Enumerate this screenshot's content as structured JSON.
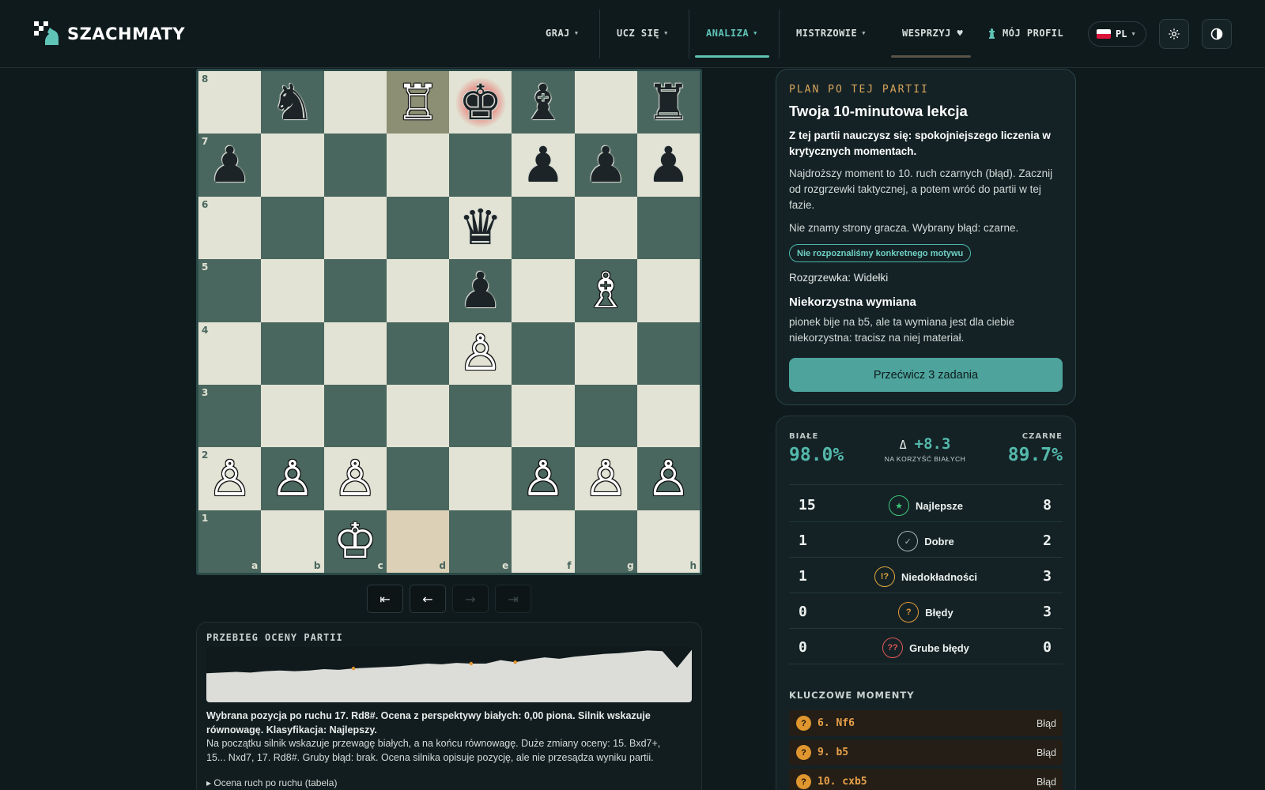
{
  "app": {
    "name": "SZACHMATY"
  },
  "nav": {
    "items": [
      {
        "label": "GRAJ"
      },
      {
        "label": "UCZ SIĘ"
      },
      {
        "label": "ANALIZA"
      },
      {
        "label": "MISTRZOWIE"
      },
      {
        "label": "WESPRZYJ ♥"
      },
      {
        "label": "MÓJ PROFIL"
      }
    ],
    "active": "ANALIZA",
    "language": "PL",
    "settings_icon": "gear-icon",
    "theme_icon": "theme-toggle-icon",
    "profile_icon": "chess-pawn-icon"
  },
  "board": {
    "ranks": [
      "8",
      "7",
      "6",
      "5",
      "4",
      "3",
      "2",
      "1"
    ],
    "files": [
      "a",
      "b",
      "c",
      "d",
      "e",
      "f",
      "g",
      "h"
    ],
    "position": [
      [
        "",
        "bN",
        "",
        "wR",
        "bK",
        "bB",
        "",
        "bR"
      ],
      [
        "bP",
        "",
        "",
        "",
        "",
        "bP",
        "bP",
        "bP"
      ],
      [
        "",
        "",
        "",
        "",
        "bQ",
        "",
        "",
        ""
      ],
      [
        "",
        "",
        "",
        "",
        "bP",
        "",
        "wB",
        ""
      ],
      [
        "",
        "",
        "",
        "",
        "wP",
        "",
        "",
        ""
      ],
      [
        "",
        "",
        "",
        "",
        "",
        "",
        "",
        ""
      ],
      [
        "wP",
        "wP",
        "wP",
        "",
        "",
        "wP",
        "wP",
        "wP"
      ],
      [
        "",
        "",
        "wK",
        "",
        "",
        "",
        "",
        ""
      ]
    ],
    "last_move": [
      "d1",
      "d8"
    ],
    "in_check": "e8",
    "controls": [
      "⇤",
      "←",
      "→",
      "⇥"
    ]
  },
  "eval_graph": {
    "title": "PRZEBIEG OCENY PARTII",
    "chart_data": {
      "type": "area",
      "x": [
        0,
        1,
        2,
        3,
        4,
        5,
        6,
        7,
        8,
        9,
        10,
        11,
        12,
        13,
        14,
        15,
        16,
        17,
        18,
        19,
        20,
        21,
        22,
        23,
        24,
        25,
        26,
        27,
        28,
        29,
        30,
        31,
        32,
        33
      ],
      "values": [
        0.2,
        0.3,
        0.4,
        0.3,
        0.5,
        0.6,
        0.5,
        0.6,
        0.8,
        0.7,
        0.9,
        1.0,
        1.1,
        1.2,
        1.4,
        1.6,
        1.5,
        1.7,
        1.6,
        1.6,
        2.1,
        1.8,
        2.2,
        2.5,
        2.3,
        2.6,
        2.8,
        3.0,
        3.1,
        3.3,
        3.5,
        3.4,
        1.0,
        3.6
      ],
      "markers": [
        10,
        18,
        21
      ],
      "ylim": [
        -4,
        4
      ]
    },
    "summary": "Wybrana pozycja po ruchu 17. Rd8#. Ocena z perspektywy białych: 0,00 piona. Silnik wskazuje równowagę. Klasyfikacja: Najlepszy.",
    "detail": "Na początku silnik wskazuje przewagę białych, a na końcu równowagę. Duże zmiany oceny: 15. Bxd7+, 15... Nxd7, 17. Rd8#. Gruby błąd: brak. Ocena silnika opisuje pozycję, ale nie przesądza wyniku partii.",
    "table_toggle": "▸ Ocena ruch po ruchu (tabela)"
  },
  "plan": {
    "kicker": "PLAN PO TEJ PARTII",
    "title": "Twoja 10-minutowa lekcja",
    "lesson": "Z tej partii nauczysz się: spokojniejszego liczenia w krytycznych momentach.",
    "body": "Najdroższy moment to 10. ruch czarnych (błąd). Zacznij od rozgrzewki taktycznej, a potem wróć do partii w tej fazie.",
    "side": "Nie znamy strony gracza. Wybrany błąd: czarne.",
    "tag": "Nie rozpoznaliśmy konkretnego motywu",
    "warmup": "Rozgrzewka: Widełki",
    "subheading": "Niekorzystna wymiana",
    "subtext": "pionek bije na b5, ale ta wymiana jest dla ciebie niekorzystna: tracisz na niej materiał.",
    "cta": "Przećwicz 3 zadania"
  },
  "stats": {
    "white_label": "BIAŁE",
    "white_accuracy": "98.0%",
    "black_label": "CZARNE",
    "black_accuracy": "89.7%",
    "delta_symbol": "Δ",
    "delta_value": "+8.3",
    "delta_caption": "NA KORZYŚĆ BIAŁYCH",
    "classes": [
      {
        "name": "Najlepsze",
        "white": "15",
        "black": "8",
        "badge": "★",
        "color": "#3fc77a"
      },
      {
        "name": "Dobre",
        "white": "1",
        "black": "2",
        "badge": "✓",
        "color": "#a9b6b3"
      },
      {
        "name": "Niedokładności",
        "white": "1",
        "black": "3",
        "badge": "!?",
        "color": "#e0a53a"
      },
      {
        "name": "Błędy",
        "white": "0",
        "black": "3",
        "badge": "?",
        "color": "#e49a3a"
      },
      {
        "name": "Grube błędy",
        "white": "0",
        "black": "0",
        "badge": "??",
        "color": "#e05555"
      }
    ],
    "key_title": "KLUCZOWE MOMENTY",
    "key_moments": [
      {
        "move": "6. Nf6",
        "badge": "?",
        "label": "Błąd"
      },
      {
        "move": "9. b5",
        "badge": "?",
        "label": "Błąd"
      },
      {
        "move": "10. cxb5",
        "badge": "?",
        "label": "Błąd"
      }
    ]
  },
  "colors": {
    "accent": "#54b9ab",
    "warning": "#e0962f",
    "board_light": "#e2e3d4",
    "board_dark": "#4a675f"
  }
}
